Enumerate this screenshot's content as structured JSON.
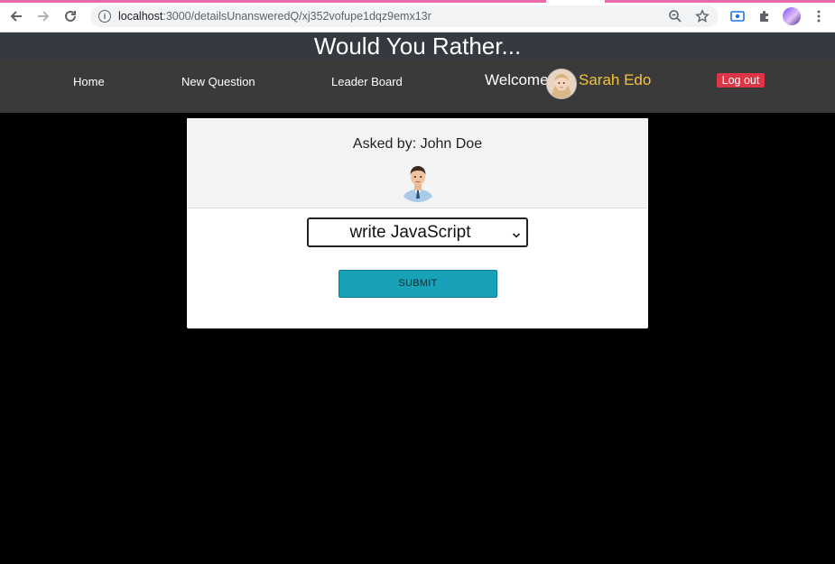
{
  "browser": {
    "url_host": "localhost",
    "url_path": ":3000/detailsUnansweredQ/xj352vofupe1dqz9emx13r"
  },
  "app": {
    "title": "Would You Rather..."
  },
  "nav": {
    "home": "Home",
    "new_question": "New Question",
    "leader_board": "Leader Board",
    "welcome": "Welcome",
    "user_name": "Sarah Edo",
    "logout": "Log out"
  },
  "question": {
    "asked_by": "Asked by: John Doe",
    "selected_option": "write JavaScript",
    "submit_label": "SUBMIT"
  },
  "colors": {
    "header_bg": "#343a40",
    "navbar_bg": "#3a3a3a",
    "user_name": "#f5c33b",
    "logout_bg": "#dc3545",
    "submit_bg": "#17a2b8",
    "page_bg": "#000000"
  }
}
